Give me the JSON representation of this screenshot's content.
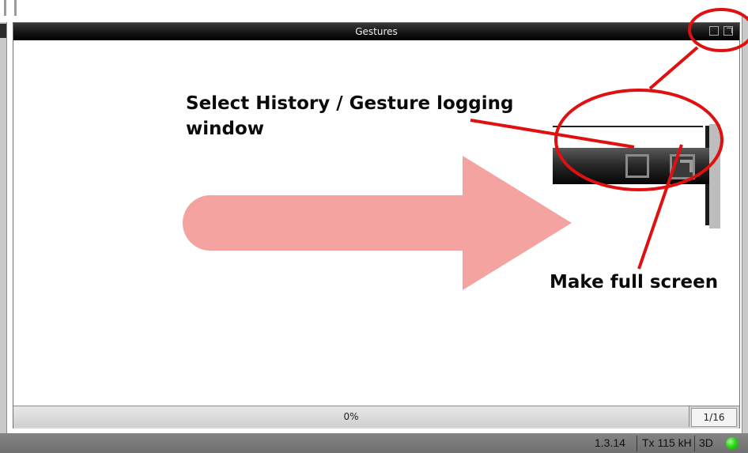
{
  "panel": {
    "title": "Gestures",
    "history_button_icon": "window-restore-icon",
    "fullscreen_button_icon": "external-expand-icon"
  },
  "annotations": {
    "select_history_line1": "Select History / Gesture logging",
    "select_history_line2": "window",
    "make_full_screen": "Make full screen",
    "arrow_color": "#f4a3a0",
    "circle_color": "#e01010"
  },
  "progress": {
    "percent_label": "0%",
    "percent_value": 0,
    "page_counter": "1/16"
  },
  "status_bar": {
    "version": "1.3.14",
    "tx_label": "Tx 115 kH",
    "mode_3d": "3D",
    "indicator_color": "#2fd21c"
  }
}
